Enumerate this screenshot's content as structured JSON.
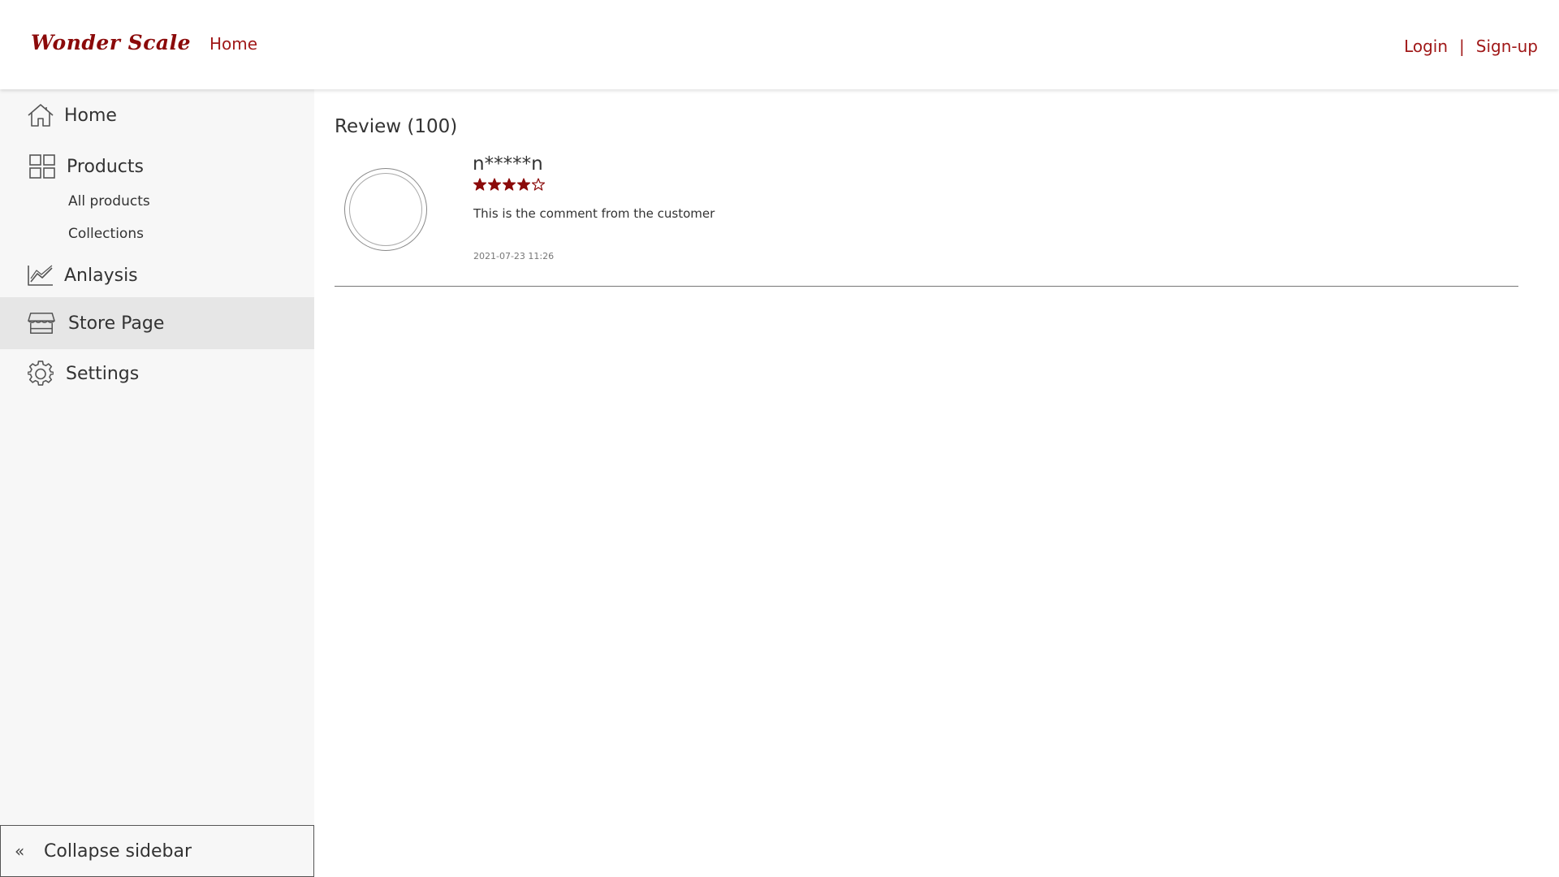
{
  "header": {
    "logo": "Wonder Scale",
    "nav_home": "Home",
    "login": "Login",
    "separator": "|",
    "signup": "Sign-up",
    "accent_color": "#a01818"
  },
  "sidebar": {
    "items": [
      {
        "label": "Home",
        "icon": "home-icon"
      },
      {
        "label": "Products",
        "icon": "grid-icon"
      },
      {
        "label": "Anlaysis",
        "icon": "chart-line-icon"
      },
      {
        "label": "Store Page",
        "icon": "store-icon",
        "active": true
      },
      {
        "label": "Settings",
        "icon": "gear-icon"
      }
    ],
    "sub_items": [
      {
        "label": "All products"
      },
      {
        "label": "Collections"
      }
    ],
    "collapse": {
      "chevron": "«",
      "label": "Collapse sidebar"
    }
  },
  "main": {
    "review_title": "Review (100)",
    "reviews": [
      {
        "reviewer": "n*****n",
        "rating": 4,
        "max_rating": 5,
        "comment": "This is the comment from the customer",
        "timestamp": "2021-07-23 11:26"
      }
    ],
    "star_color": "#8b0a0a"
  }
}
